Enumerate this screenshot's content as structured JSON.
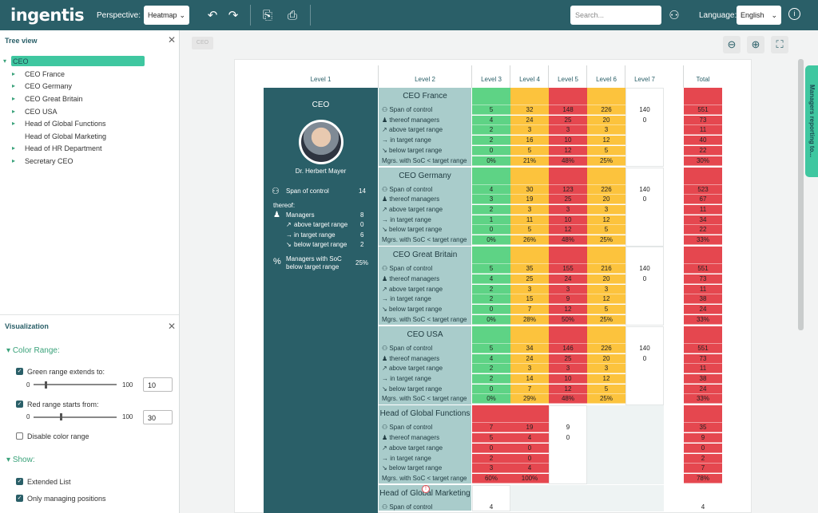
{
  "topbar": {
    "logo": "ingentis",
    "perspective_label": "Perspective:",
    "perspective_value": "Heatmap",
    "search_placeholder": "Search...",
    "language_label": "Language:",
    "language_value": "English"
  },
  "tree": {
    "title": "Tree view",
    "items": [
      "CEO",
      "CEO France",
      "CEO Germany",
      "CEO Great Britain",
      "CEO USA",
      "Head of Global Functions",
      "Head of Global Marketing",
      "Head of HR Department",
      "Secretary CEO"
    ]
  },
  "viz": {
    "title": "Visualization",
    "color_range": "Color Range:",
    "green_label": "Green range extends to:",
    "green_min": "0",
    "green_max": "100",
    "green_value": "10",
    "green_pct": 10,
    "red_label": "Red range starts from:",
    "red_min": "0",
    "red_max": "100",
    "red_value": "30",
    "red_pct": 30,
    "disable_label": "Disable color range",
    "show": "Show:",
    "extended_list": "Extended List",
    "only_managing": "Only managing positions"
  },
  "breadcrumb": "CEO",
  "side_tab": "Managers reporting to...",
  "levels": [
    "Level 1",
    "Level 2",
    "Level 3",
    "Level 4",
    "Level 5",
    "Level 6",
    "Level 7",
    "Total"
  ],
  "ceo": {
    "title": "CEO",
    "name": "Dr. Herbert Mayer",
    "span_label": "Span of control",
    "span_value": "14",
    "thereof": "thereof:",
    "managers_label": "Managers",
    "managers_value": "8",
    "above_label": "above target range",
    "above_value": "0",
    "in_label": "in target range",
    "in_value": "6",
    "below_label": "below target range",
    "below_value": "2",
    "soc_label": "Managers with SoC below target range",
    "soc_value": "25%"
  },
  "metric_labels": [
    "Span of control",
    "thereof managers",
    "above target range",
    "in target range",
    "below target range",
    "Mgrs. with SoC < target range"
  ],
  "colors": {
    "green": "#5ed385",
    "yellow": "#fcc33d",
    "red": "#e5474f",
    "teal": "#2a5f68",
    "mint": "#3fc7a0"
  },
  "blocks": [
    {
      "name": "CEO France",
      "cols": [
        {
          "v": [
            "5",
            "4",
            "2",
            "2",
            "0",
            "0%"
          ],
          "c": "g"
        },
        {
          "v": [
            "32",
            "24",
            "3",
            "16",
            "5",
            "21%"
          ],
          "c": "y"
        },
        {
          "v": [
            "148",
            "25",
            "3",
            "10",
            "12",
            "48%"
          ],
          "c": "r"
        },
        {
          "v": [
            "226",
            "20",
            "3",
            "12",
            "5",
            "25%"
          ],
          "c": "y"
        },
        {
          "v": [
            "140",
            "0",
            "",
            "",
            "",
            ""
          ],
          "c": "w"
        }
      ],
      "total": [
        "551",
        "73",
        "11",
        "40",
        "22",
        "30%"
      ]
    },
    {
      "name": "CEO Germany",
      "cols": [
        {
          "v": [
            "4",
            "3",
            "2",
            "1",
            "0",
            "0%"
          ],
          "c": "g"
        },
        {
          "v": [
            "30",
            "19",
            "3",
            "11",
            "5",
            "26%"
          ],
          "c": "y"
        },
        {
          "v": [
            "123",
            "25",
            "3",
            "10",
            "12",
            "48%"
          ],
          "c": "r"
        },
        {
          "v": [
            "226",
            "20",
            "3",
            "12",
            "5",
            "25%"
          ],
          "c": "y"
        },
        {
          "v": [
            "140",
            "0",
            "",
            "",
            "",
            ""
          ],
          "c": "w"
        }
      ],
      "total": [
        "523",
        "67",
        "11",
        "34",
        "22",
        "33%"
      ]
    },
    {
      "name": "CEO Great Britain",
      "cols": [
        {
          "v": [
            "5",
            "4",
            "2",
            "2",
            "0",
            "0%"
          ],
          "c": "g"
        },
        {
          "v": [
            "35",
            "25",
            "3",
            "15",
            "7",
            "28%"
          ],
          "c": "y"
        },
        {
          "v": [
            "155",
            "24",
            "3",
            "9",
            "12",
            "50%"
          ],
          "c": "r"
        },
        {
          "v": [
            "216",
            "20",
            "3",
            "12",
            "5",
            "25%"
          ],
          "c": "y"
        },
        {
          "v": [
            "140",
            "0",
            "",
            "",
            "",
            ""
          ],
          "c": "w"
        }
      ],
      "total": [
        "551",
        "73",
        "11",
        "38",
        "24",
        "33%"
      ]
    },
    {
      "name": "CEO USA",
      "cols": [
        {
          "v": [
            "5",
            "4",
            "2",
            "2",
            "0",
            "0%"
          ],
          "c": "g"
        },
        {
          "v": [
            "34",
            "24",
            "3",
            "14",
            "7",
            "29%"
          ],
          "c": "y"
        },
        {
          "v": [
            "146",
            "25",
            "3",
            "10",
            "12",
            "48%"
          ],
          "c": "r"
        },
        {
          "v": [
            "226",
            "20",
            "3",
            "12",
            "5",
            "25%"
          ],
          "c": "y"
        },
        {
          "v": [
            "140",
            "0",
            "",
            "",
            "",
            ""
          ],
          "c": "w"
        }
      ],
      "total": [
        "551",
        "73",
        "11",
        "38",
        "24",
        "33%"
      ]
    },
    {
      "name": "Head of Global Functions",
      "cols": [
        {
          "v": [
            "7",
            "5",
            "0",
            "2",
            "3",
            "60%"
          ],
          "c": "r"
        },
        {
          "v": [
            "19",
            "4",
            "0",
            "0",
            "4",
            "100%"
          ],
          "c": "r"
        },
        {
          "v": [
            "9",
            "0",
            "",
            "",
            "",
            ""
          ],
          "c": "w"
        }
      ],
      "total": [
        "35",
        "9",
        "0",
        "2",
        "7",
        "78%"
      ]
    },
    {
      "name": "Head of Global Marketing",
      "cols": [
        {
          "v": [
            "4"
          ],
          "c": "w"
        }
      ],
      "total": [
        "4"
      ]
    }
  ]
}
